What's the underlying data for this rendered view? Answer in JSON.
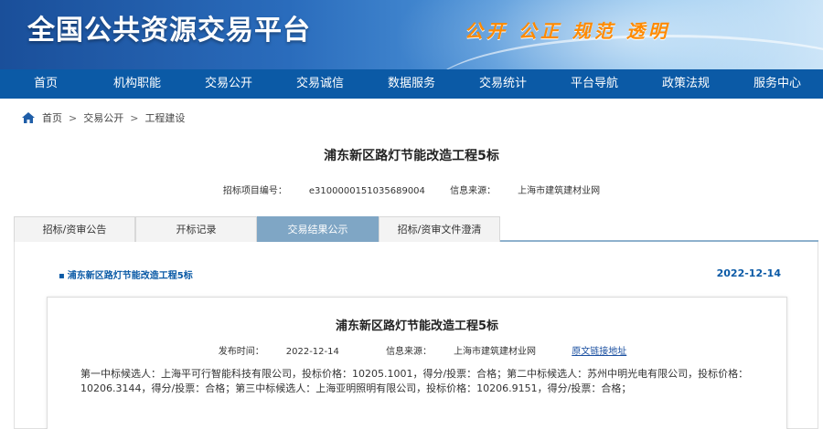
{
  "header": {
    "site_title": "全国公共资源交易平台",
    "slogan": "公开 公正 规范 透明"
  },
  "nav": [
    "首页",
    "机构职能",
    "交易公开",
    "交易诚信",
    "数据服务",
    "交易统计",
    "平台导航",
    "政策法规",
    "服务中心"
  ],
  "breadcrumb": {
    "home": "首页",
    "level1": "交易公开",
    "level2": "工程建设",
    "separator": ">"
  },
  "project": {
    "title": "浦东新区路灯节能改造工程5标",
    "code_label": "招标项目编号：",
    "code": "e3100000151035689004",
    "source_label": "信息来源：",
    "source": "上海市建筑建材业网"
  },
  "tabs": [
    {
      "label": "招标/资审公告",
      "active": false
    },
    {
      "label": "开标记录",
      "active": false
    },
    {
      "label": "交易结果公示",
      "active": true
    },
    {
      "label": "招标/资审文件澄清",
      "active": false
    }
  ],
  "list": {
    "bullet": "▪",
    "item_title": "浦东新区路灯节能改造工程5标",
    "item_date": "2022-12-14"
  },
  "document": {
    "title": "浦东新区路灯节能改造工程5标",
    "publish_label": "发布时间：",
    "publish_date": "2022-12-14",
    "source_label": "信息来源：",
    "source": "上海市建筑建材业网",
    "original_link": "原文链接地址",
    "body": "第一中标候选人：上海平可行智能科技有限公司，投标价格：10205.1001，得分/投票：合格；第二中标候选人：苏州中明光电有限公司，投标价格：10206.3144，得分/投票：合格；第三中标候选人：上海亚明照明有限公司，投标价格：10206.9151，得分/投票：合格；"
  },
  "colors": {
    "nav_bg": "#0b5aa6",
    "active_tab": "#7fa6c5",
    "link": "#0b5aa6",
    "slogan": "#ff8a00"
  }
}
